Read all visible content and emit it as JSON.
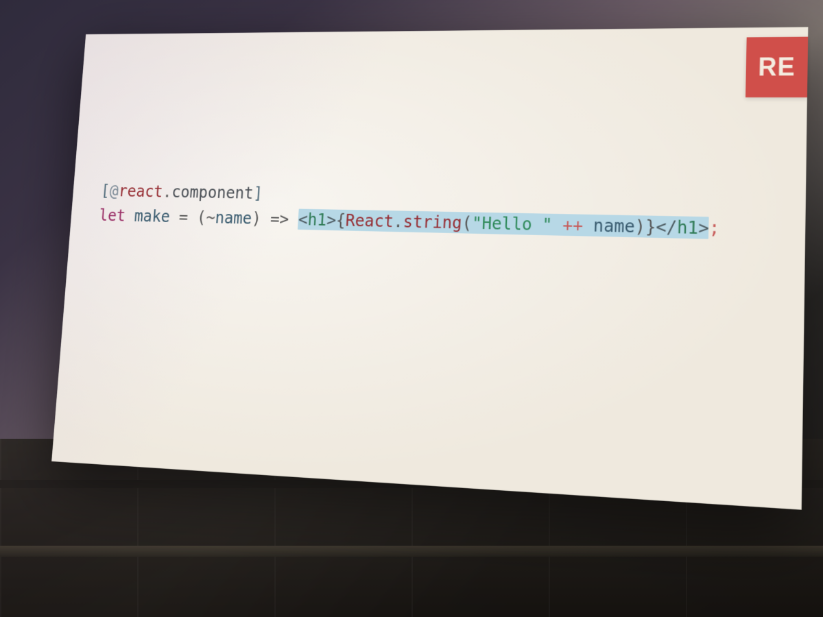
{
  "logo": {
    "text": "RE"
  },
  "code": {
    "line1": {
      "open_bracket": "[",
      "at": "@",
      "namespace": "react",
      "dot": ".",
      "member": "component",
      "close_bracket": "]"
    },
    "line2": {
      "kw_let": "let",
      "ident_make": "make",
      "eq": " = ",
      "lparen": "(",
      "tilde": "~",
      "param_name": "name",
      "rparen": ")",
      "arrow": " => ",
      "jsx_open_lt": "<",
      "jsx_open_tag": "h1",
      "jsx_open_gt": ">",
      "lbrace": "{",
      "react_ns": "React",
      "react_dot": ".",
      "react_fn": "string",
      "call_lparen": "(",
      "str": "\"Hello \"",
      "concat": " ++ ",
      "arg_name": "name",
      "call_rparen": ")",
      "rbrace": "}",
      "jsx_close_lt": "</",
      "jsx_close_tag": "h1",
      "jsx_close_gt": ">",
      "semi": ";"
    }
  }
}
